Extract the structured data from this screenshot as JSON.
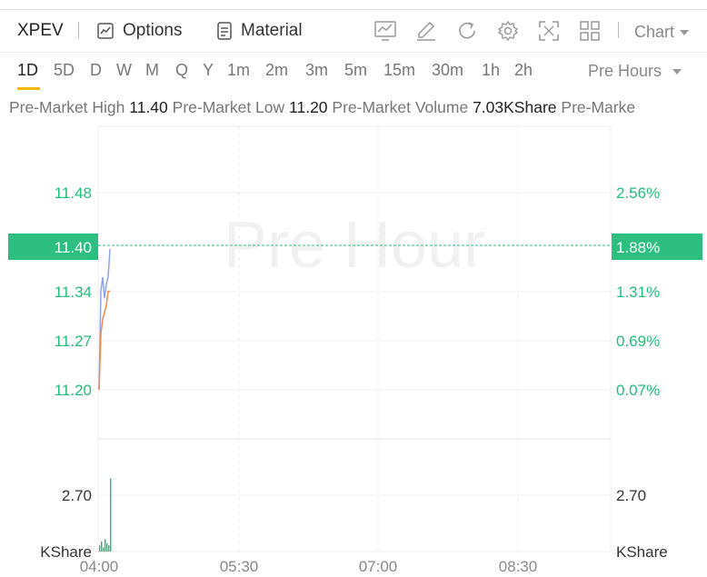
{
  "toolbar": {
    "ticker": "XPEV",
    "options_label": "Options",
    "material_label": "Material",
    "chart_label": "Chart"
  },
  "periods": [
    "1D",
    "5D",
    "D",
    "W",
    "M",
    "Q",
    "Y",
    "1m",
    "2m",
    "3m",
    "5m",
    "15m",
    "30m",
    "1h",
    "2h"
  ],
  "active_period": "1D",
  "session_label": "Pre Hours",
  "info": {
    "high_label": "Pre-Market High",
    "high_value": "11.40",
    "low_label": "Pre-Market Low",
    "low_value": "11.20",
    "volume_label": "Pre-Market Volume",
    "volume_value": "7.03KShare",
    "next_label": "Pre-Marke"
  },
  "watermark": "Pre Hour",
  "colors": {
    "green": "#1fbf7a",
    "price_line": "#8da3f2",
    "avg_line": "#f08a4b",
    "dashed": "#2dbf7f"
  },
  "chart_data": {
    "type": "line",
    "price_axis": {
      "ticks": [
        "11.48",
        "11.34",
        "11.27",
        "11.20"
      ],
      "current": "11.40",
      "pct_ticks": [
        "2.56%",
        "1.31%",
        "0.69%",
        "0.07%"
      ],
      "current_pct": "1.88%",
      "ylim": [
        11.2,
        11.48
      ]
    },
    "volume_axis": {
      "tick": "2.70",
      "unit": "KShare"
    },
    "time_ticks": [
      "04:00",
      "05:30",
      "07:00",
      "08:30"
    ],
    "series": [
      {
        "values": [
          11.2,
          11.34,
          11.36,
          11.33,
          11.35,
          11.36,
          11.4
        ]
      },
      {
        "values": [
          11.2,
          11.28,
          11.3,
          11.31,
          11.32,
          11.34,
          11.34
        ]
      }
    ],
    "volume": [
      0.3,
      0.5,
      0.2,
      0.6,
      0.4,
      0.3,
      3.5
    ]
  }
}
